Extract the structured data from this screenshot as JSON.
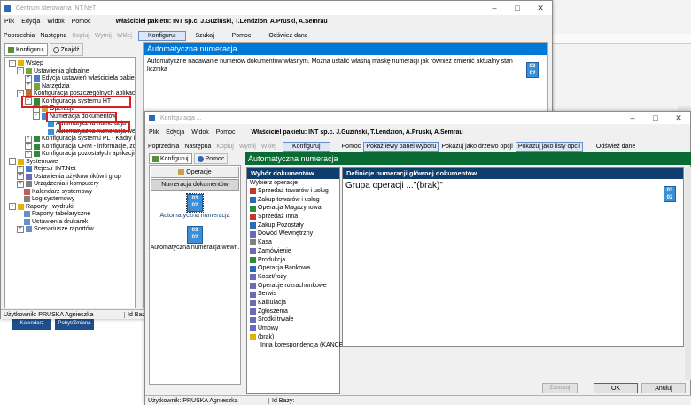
{
  "background_window": {
    "title": "Centrum sterowania INT.NeT",
    "menu": [
      "Plik",
      "Edycja",
      "Widok",
      "Pomoc"
    ],
    "owner": "Właściciel pakietu: INT sp.c. J.Guziński, T.Lendzion, A.Pruski, A.Semrau",
    "toolbar": {
      "prev": "Poprzednia",
      "next": "Następna",
      "copy": "Kopiuj",
      "cut": "Wytnij",
      "paste": "Wklej",
      "configure": "Konfiguruj",
      "search": "Szukaj",
      "help": "Pomoc",
      "refresh": "Odśwież dane"
    },
    "tabs": {
      "configure": "Konfiguruj",
      "find": "Znajdź"
    },
    "tree": [
      {
        "label": "Wstęp",
        "level": 0,
        "expander": "-"
      },
      {
        "label": "Ustawienia globalne",
        "level": 1,
        "expander": "-"
      },
      {
        "label": "Edycja ustawień właściciela pakietu",
        "level": 2,
        "expander": "+"
      },
      {
        "label": "Narzędzia",
        "level": 2,
        "expander": "+"
      },
      {
        "label": "Konfiguracja poszczególnych aplikacji",
        "level": 1,
        "expander": "-"
      },
      {
        "label": "Konfiguracja systemu HT",
        "level": 2,
        "expander": "-"
      },
      {
        "label": "Operacje",
        "level": 3,
        "expander": "+"
      },
      {
        "label": "Numeracja dokumentów",
        "level": 3,
        "expander": "-"
      },
      {
        "label": "Automatyczna numeracja",
        "level": 4,
        "expander": ""
      },
      {
        "label": "Automatyczna numeracja wew",
        "level": 4,
        "expander": ""
      },
      {
        "label": "Konfiguracja systemu PL - Kadry i płac",
        "level": 2,
        "expander": "+"
      },
      {
        "label": "Konfiguracja CRM - informacje, zdarze",
        "level": 2,
        "expander": "+"
      },
      {
        "label": "Konfiguracja pozostałych aplikacji",
        "level": 2,
        "expander": "+"
      },
      {
        "label": "Systemowe",
        "level": 0,
        "expander": "-"
      },
      {
        "label": "Rejestr INT.Net",
        "level": 1,
        "expander": "+"
      },
      {
        "label": "Ustawienia użytkowników i grup",
        "level": 1,
        "expander": "+"
      },
      {
        "label": "Urządzenia i komputery",
        "level": 1,
        "expander": "+"
      },
      {
        "label": "Kalendarz systemowy",
        "level": 1,
        "expander": ""
      },
      {
        "label": "Log systemowy",
        "level": 1,
        "expander": ""
      },
      {
        "label": "Raporty i wydruki",
        "level": 0,
        "expander": "-"
      },
      {
        "label": "Raporty tabelaryczne",
        "level": 1,
        "expander": ""
      },
      {
        "label": "Ustawienia drukarek",
        "level": 1,
        "expander": ""
      },
      {
        "label": "Scenariusze raportów",
        "level": 1,
        "expander": "+"
      }
    ],
    "content_title": "Automatyczna numeracja",
    "content_text": "Automatyczne nadawanie numerów dokumentów własnym. Można ustalić własną maskę numeracji jak również zmienić aktualny stan licznika",
    "status_user": "Użytkownik: PRUSKA Agnieszka",
    "status_id": "Id Bazy:"
  },
  "behind_buttons": [
    "Kalendarz",
    "Pobyt/Zmiana"
  ],
  "icon_text": "03\n02",
  "front_window": {
    "title": "Konfiguracja ...",
    "menu": [
      "Plik",
      "Edycja",
      "Widok",
      "Pomoc"
    ],
    "owner": "Właściciel pakietu: INT sp.c. J.Guziński, T.Lendzion, A.Pruski, A.Semrau",
    "toolbar": {
      "prev": "Poprzednia",
      "next": "Następna",
      "copy": "Kopiuj",
      "cut": "Wytnij",
      "paste": "Wklej",
      "configure": "Konfiguruj",
      "help": "Pomoc",
      "show_left": "Pokaż lewy panel wyboru",
      "show_tree": "Pokazuj jako drzewo opcji",
      "show_list": "Pokazuj jako listy opcji",
      "refresh": "Odśwież dane"
    },
    "tabs": {
      "configure": "Konfiguruj",
      "help": "Pomoc"
    },
    "left_sections": {
      "operations": "Operacje",
      "numbering": "Numeracja dokumentów"
    },
    "left_items": [
      "Automatyczna numeracja",
      "Automatyczna numeracja wewn."
    ],
    "header": "Automatyczna numeracja",
    "select_docs_title": "Wybór dokumentów",
    "select_ops_label": "Wybierz operacje",
    "doc_list": [
      "Sprzedaż towarów i usług",
      "Zakup towarów i usług",
      "Operacja Magazynowa",
      "Sprzedaż Inna",
      "Zakup Pozostały",
      "Dowód Wewnętrzny",
      "Kasa",
      "Zamówienie",
      "Produkcja",
      "Operacja Bankowa",
      "Koszt/rozy",
      "Operacje rozrachunkowe",
      "Serwis",
      "Kalkulacja",
      "Zgłoszenia",
      "Środki trwałe",
      "Umowy",
      "(brak)",
      "Inna korespondencja (KANCE"
    ],
    "definitions_title": "Definicje numeracji głównej dokumentów",
    "definition_text": "Grupa operacji ...\"(brak)\"",
    "buttons": {
      "apply": "Zastosuj",
      "ok": "OK",
      "cancel": "Anuluj"
    },
    "status_user": "Użytkownik: PRUSKA Agnieszka",
    "status_id": "Id Bazy:"
  },
  "colors": {
    "accent_blue": "#0078d7",
    "accent_green": "#0a6a33",
    "header_dark": "#0f3d6e",
    "highlight_red": "#d62020"
  }
}
